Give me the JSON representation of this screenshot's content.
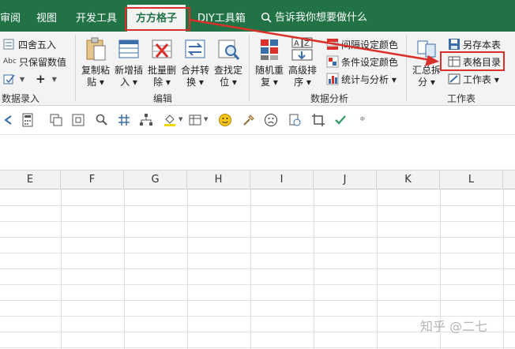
{
  "menubar": {
    "tabs": [
      {
        "label": "审阅"
      },
      {
        "label": "视图"
      },
      {
        "label": "开发工具"
      },
      {
        "label": "方方格子",
        "active": true
      },
      {
        "label": "DIY工具箱"
      }
    ],
    "search_placeholder": "告诉我你想要做什么"
  },
  "ribbon": {
    "group_numbers": {
      "label": "数据录入",
      "items": [
        "四舍五入",
        "只保留数值"
      ],
      "abc": "Abc",
      "plus": "+"
    },
    "group_edit": {
      "label": "编辑",
      "buttons": [
        {
          "l1": "复制粘",
          "l2": "贴 ▾"
        },
        {
          "l1": "新增插",
          "l2": "入 ▾"
        },
        {
          "l1": "批量删",
          "l2": "除 ▾"
        },
        {
          "l1": "合并转",
          "l2": "换 ▾"
        },
        {
          "l1": "查找定",
          "l2": "位 ▾"
        }
      ]
    },
    "group_analysis": {
      "label": "数据分析",
      "buttons": [
        {
          "l1": "随机重",
          "l2": "复 ▾"
        },
        {
          "l1": "高级排",
          "l2": "序 ▾"
        }
      ],
      "small": [
        "间隔设定颜色",
        "条件设定颜色",
        "统计与分析 ▾"
      ]
    },
    "group_worksheet": {
      "label": "工作表",
      "summary": {
        "l1": "汇总拆",
        "l2": "分 ▾"
      },
      "small": [
        "另存本表",
        "表格目录",
        "工作表 ▾"
      ]
    }
  },
  "colors": {
    "menubar": "#217346",
    "highlight": "#d9302a",
    "ribbon_bg": "#f3f3f3"
  },
  "grid": {
    "columns": [
      "E",
      "F",
      "G",
      "H",
      "I",
      "J",
      "K",
      "L"
    ]
  },
  "watermark": "知乎 @二七"
}
